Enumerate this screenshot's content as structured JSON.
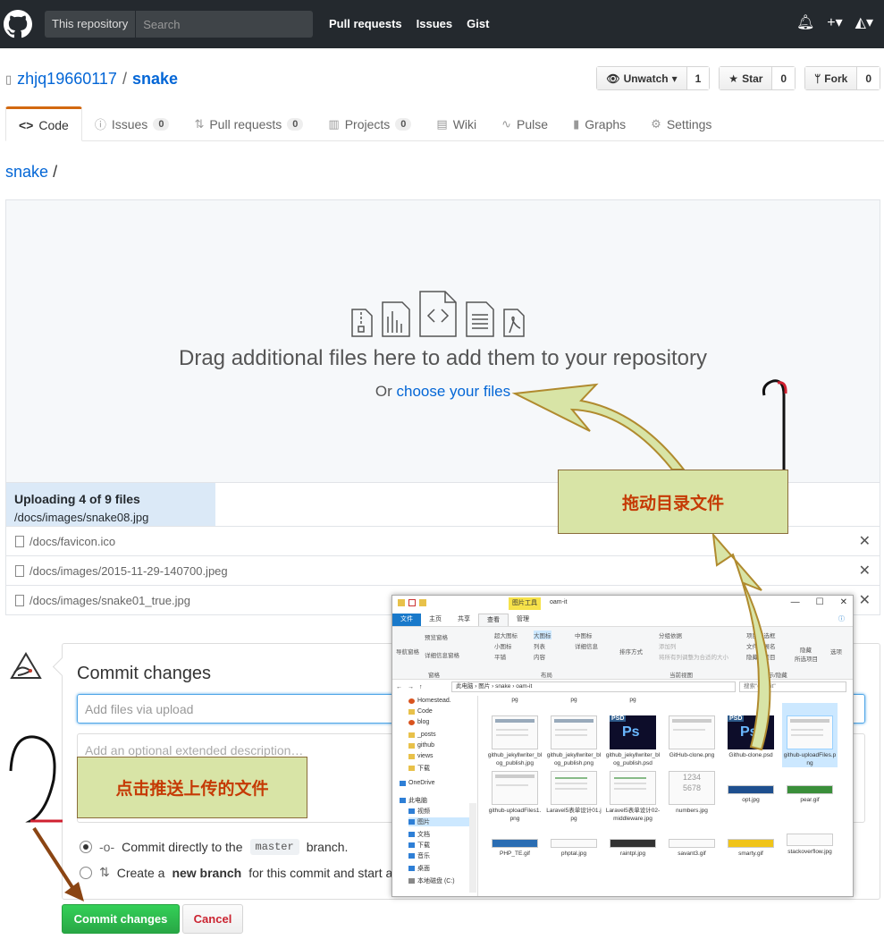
{
  "header": {
    "search_scope": "This repository",
    "search_placeholder": "Search",
    "nav": [
      "Pull requests",
      "Issues",
      "Gist"
    ],
    "icons": [
      "bell-icon",
      "plus-icon",
      "avatar"
    ]
  },
  "repo": {
    "owner": "zhjq19660117",
    "separator": "/",
    "name": "snake",
    "watch_label": "Unwatch",
    "watch_count": "1",
    "star_label": "Star",
    "star_count": "0",
    "fork_label": "Fork",
    "fork_count": "0"
  },
  "tabs": {
    "code": "Code",
    "issues": "Issues",
    "issues_count": "0",
    "pulls": "Pull requests",
    "pulls_count": "0",
    "projects": "Projects",
    "projects_count": "0",
    "wiki": "Wiki",
    "pulse": "Pulse",
    "graphs": "Graphs",
    "settings": "Settings"
  },
  "breadcrumb": {
    "repo": "snake",
    "slash": "/"
  },
  "dropzone": {
    "title": "Drag additional files here to add them to your repository",
    "or": "Or",
    "choose": "choose your files"
  },
  "upload": {
    "status": "Uploading 4 of 9 files",
    "current": "/docs/images/snake08.jpg",
    "progress_fraction": 0.24,
    "files": [
      "/docs/favicon.ico",
      "/docs/images/2015-11-29-140700.jpeg",
      "/docs/images/snake01_true.jpg"
    ]
  },
  "commit": {
    "title": "Commit changes",
    "summary_placeholder": "Add files via upload",
    "desc_placeholder": "Add an optional extended description…",
    "direct_prefix": "Commit directly to the",
    "branch": "master",
    "direct_suffix": "branch.",
    "new_prefix": "Create a",
    "new_bold": "new branch",
    "new_suffix": "for this commit and start a p",
    "submit": "Commit changes",
    "cancel": "Cancel"
  },
  "callouts": {
    "drag": "拖动目录文件",
    "push": "点击推送上传的文件"
  },
  "explorer": {
    "tool_tab": "图片工具",
    "title": "oam-it",
    "menu": [
      "文件",
      "主页",
      "共享",
      "查看",
      "管理"
    ],
    "ribbon": {
      "nav_pane": "导航窗格",
      "preview_pane": "预览窗格",
      "details_pane": "详细信息窗格",
      "group_panes": "窗格",
      "xl_icons": "超大图标",
      "l_icons": "大图标",
      "m_icons": "中图标",
      "s_icons": "小图标",
      "list": "列表",
      "details": "详细信息",
      "tiles": "平铺",
      "content": "内容",
      "group_layout": "布局",
      "sort": "排序方式",
      "group_by": "分组依据",
      "add_col": "添加列",
      "fit_cols": "将所有列调整为合适的大小",
      "group_view": "当前视图",
      "checkbox": "项目复选框",
      "ext": "文件扩展名",
      "hidden": "隐藏的项目",
      "hide_sel": "隐藏",
      "hide_sel2": "所选项目",
      "group_show": "显示/隐藏",
      "options": "选项"
    },
    "path": [
      "此电脑",
      "图片",
      "snake",
      "oam-it"
    ],
    "search": "搜索\"oam-it\"",
    "nav": [
      "Homestead.",
      "Code",
      "blog",
      "_posts",
      "github",
      "views",
      "下载",
      "OneDrive",
      "此电脑",
      "视频",
      "图片",
      "文档",
      "下载",
      "音乐",
      "桌面",
      "本地磁盘 (C:)"
    ],
    "files": [
      "github_jekyllwriter_blog_publish.jpg",
      "github_jekyllwriter_blog_publish.png",
      "github_jekyllwriter_blog_publish.psd",
      "GitHub-clone.png",
      "Github-clone.psd",
      "github-uploadFiles.png",
      "github-uploadFiles1.png",
      "Laravel5表单设计01.jpg",
      "Laravel5表单设计02-middleware.jpg",
      "numbers.jpg",
      "opt.jpg",
      "pear.gif",
      "PHP_TE.gif",
      "phptal.jpg",
      "raintpl.jpg",
      "savant3.gif",
      "smarty.gif",
      "stackoverflow.jpg"
    ],
    "top_row": [
      "pg",
      "pg",
      "pg"
    ]
  },
  "colors": {
    "header_bg": "#24292e",
    "link": "#0366d6",
    "tab_accent": "#d26911",
    "commit_green": "#28a745",
    "callout_bg": "#d8e4a6",
    "callout_text": "#c53a05",
    "arrow": "#b08a2e"
  }
}
